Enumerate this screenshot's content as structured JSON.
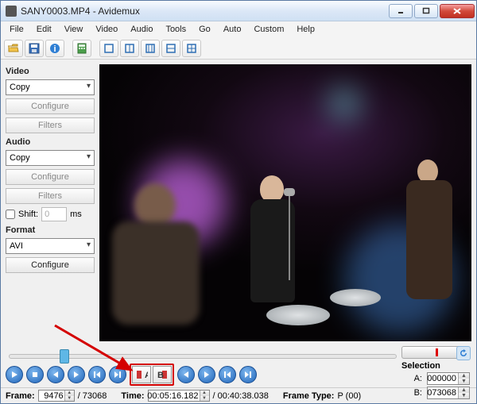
{
  "window": {
    "title": "SANY0003.MP4 - Avidemux"
  },
  "menu": {
    "items": [
      "File",
      "Edit",
      "View",
      "Video",
      "Audio",
      "Tools",
      "Go",
      "Auto",
      "Custom",
      "Help"
    ]
  },
  "sidebar": {
    "video_label": "Video",
    "video_codec": "Copy",
    "video_configure": "Configure",
    "video_filters": "Filters",
    "audio_label": "Audio",
    "audio_codec": "Copy",
    "audio_configure": "Configure",
    "audio_filters": "Filters",
    "shift_label": "Shift:",
    "shift_value": "0",
    "shift_unit": "ms",
    "format_label": "Format",
    "format_value": "AVI",
    "format_configure": "Configure"
  },
  "selection": {
    "label": "Selection",
    "a_label": "A:",
    "a_value": "000000",
    "b_label": "B:",
    "b_value": "073068"
  },
  "status": {
    "frame_label": "Frame:",
    "frame_value": "9476",
    "frame_total": "/ 73068",
    "time_label": "Time:",
    "time_value": "00:05:16.182",
    "time_total": "/ 00:40:38.038",
    "frametype_label": "Frame Type:",
    "frametype_value": "P (00)"
  },
  "slider": {
    "position_pct": 13
  }
}
